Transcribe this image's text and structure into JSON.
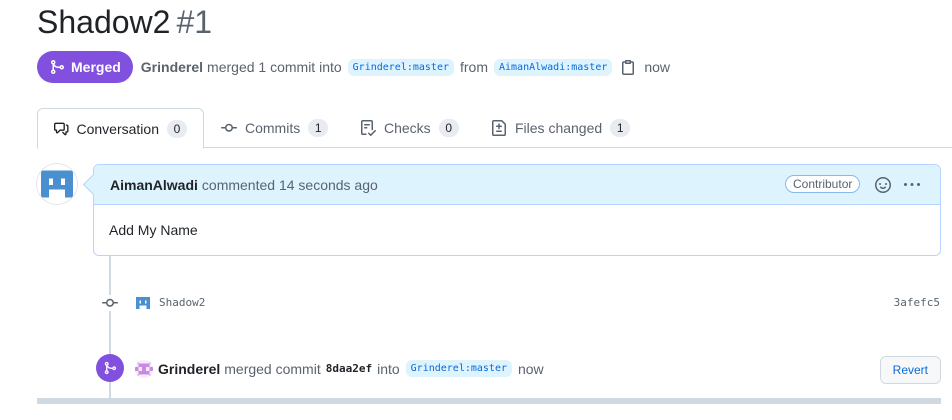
{
  "pr": {
    "title": "Shadow2",
    "number": "#1",
    "state_label": "Merged",
    "author": "Grinderel",
    "merged_text": "merged 1 commit into",
    "base_branch": "Grinderel:master",
    "from_text": "from",
    "head_branch": "AimanAlwadi:master",
    "time": "now"
  },
  "tabs": [
    {
      "label": "Conversation",
      "count": "0"
    },
    {
      "label": "Commits",
      "count": "1"
    },
    {
      "label": "Checks",
      "count": "0"
    },
    {
      "label": "Files changed",
      "count": "1"
    }
  ],
  "comment": {
    "user": "AimanAlwadi",
    "action": "commented 14 seconds ago",
    "role": "Contributor",
    "body": "Add My Name"
  },
  "commit": {
    "message": "Shadow2",
    "sha": "3afefc5"
  },
  "merge_event": {
    "user": "Grinderel",
    "text": "merged commit",
    "sha": "8daa2ef",
    "into_text": "into",
    "branch": "Grinderel:master",
    "time": "now",
    "revert_label": "Revert"
  },
  "colors": {
    "merged": "#8250df",
    "link": "#0969da",
    "comment_header": "#ddf4ff"
  }
}
